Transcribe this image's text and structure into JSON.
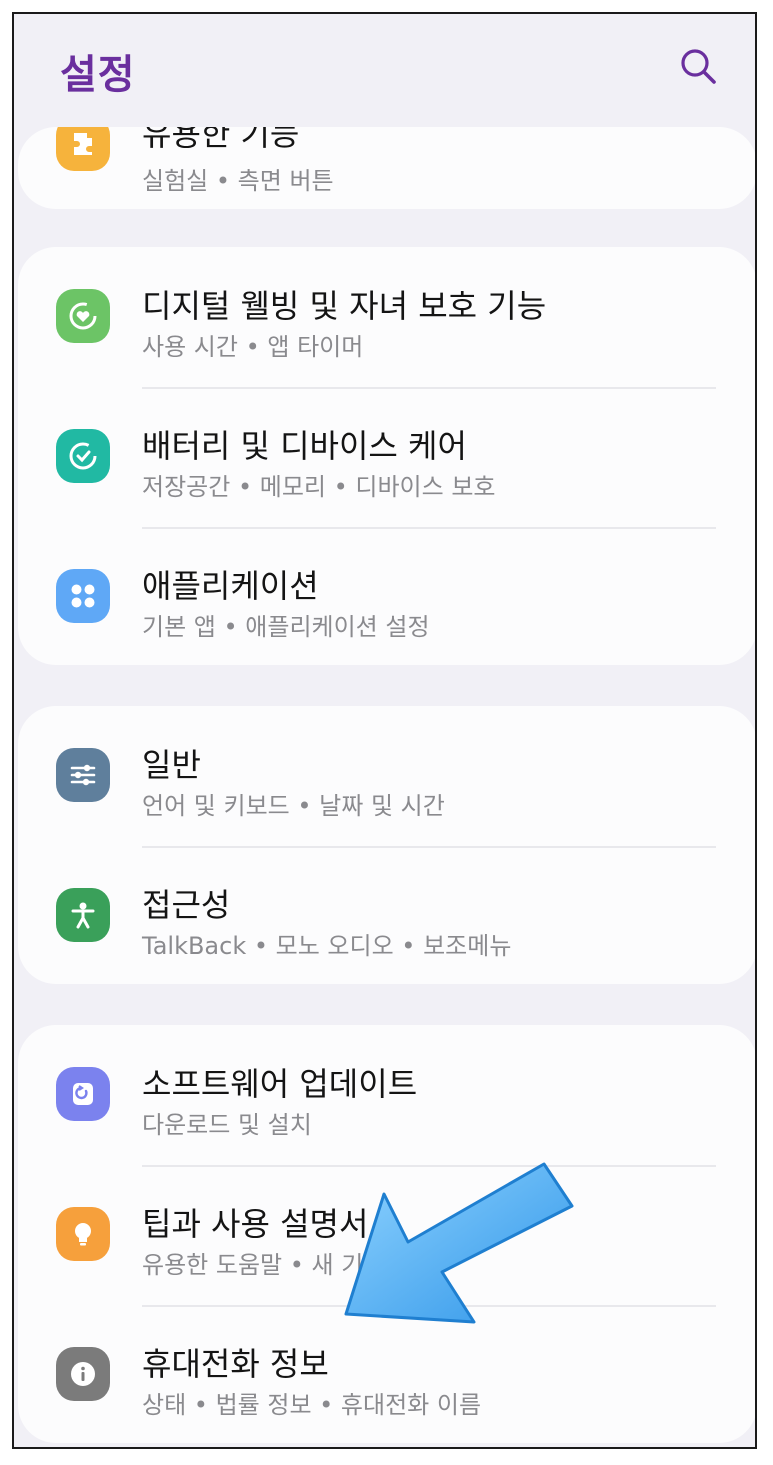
{
  "header": {
    "title": "설정",
    "search_icon": "search-icon"
  },
  "groups": [
    {
      "items": [
        {
          "title": "유용한 기능",
          "subtitle": "실험실 • 측면 버튼",
          "icon": "puzzle-icon",
          "color": "#f6b33c"
        }
      ]
    },
    {
      "items": [
        {
          "title": "디지털 웰빙 및 자녀 보호 기능",
          "subtitle": "사용 시간 • 앱 타이머",
          "icon": "wellbeing-icon",
          "color": "#6cc466"
        },
        {
          "title": "배터리 및 디바이스 케어",
          "subtitle": "저장공간 • 메모리 • 디바이스 보호",
          "icon": "device-care-icon",
          "color": "#21b9a3"
        },
        {
          "title": "애플리케이션",
          "subtitle": "기본 앱 • 애플리케이션 설정",
          "icon": "apps-icon",
          "color": "#5fa8f6"
        }
      ]
    },
    {
      "items": [
        {
          "title": "일반",
          "subtitle": "언어 및 키보드 • 날짜 및 시간",
          "icon": "sliders-icon",
          "color": "#5f7f9c"
        },
        {
          "title": "접근성",
          "subtitle": "TalkBack • 모노 오디오 • 보조메뉴",
          "icon": "accessibility-icon",
          "color": "#3aa05a"
        }
      ]
    },
    {
      "items": [
        {
          "title": "소프트웨어 업데이트",
          "subtitle": "다운로드 및 설치",
          "icon": "update-icon",
          "color": "#7b82ee"
        },
        {
          "title": "팁과 사용 설명서",
          "subtitle": "유용한 도움말 • 새 기능",
          "icon": "lightbulb-icon",
          "color": "#f6a03c"
        },
        {
          "title": "휴대전화 정보",
          "subtitle": "상태 • 법률 정보 • 휴대전화 이름",
          "icon": "info-icon",
          "color": "#7b7b7b"
        }
      ]
    }
  ],
  "annotation": {
    "icon": "blue-arrow-icon",
    "color": "#3ea9f5"
  }
}
